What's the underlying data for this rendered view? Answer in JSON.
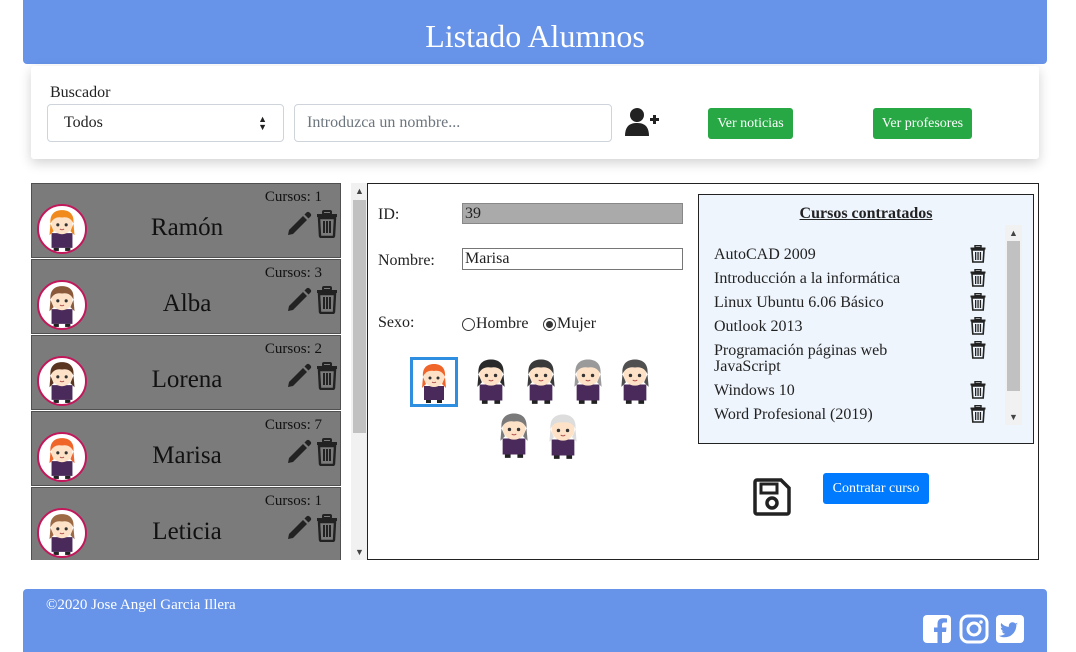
{
  "header": {
    "title": "Listado Alumnos"
  },
  "search": {
    "label": "Buscador",
    "filter_selected": "Todos",
    "name_placeholder": "Introduzca un nombre...",
    "name_value": "",
    "news_button": "Ver noticias",
    "teachers_button": "Ver profesores",
    "add_user_icon": "user-plus-icon"
  },
  "students": [
    {
      "name": "Ramón",
      "courses": "Cursos: 1",
      "avatar_hair": "#f08a1c"
    },
    {
      "name": "Alba",
      "courses": "Cursos: 3",
      "avatar_hair": "#8a5a3a"
    },
    {
      "name": "Lorena",
      "courses": "Cursos: 2",
      "avatar_hair": "#5a3620"
    },
    {
      "name": "Marisa",
      "courses": "Cursos: 7",
      "avatar_hair": "#f0662a"
    },
    {
      "name": "Leticia",
      "courses": "Cursos: 1",
      "avatar_hair": "#9c6a44"
    }
  ],
  "detail": {
    "id_label": "ID:",
    "id_value": "39",
    "name_label": "Nombre:",
    "name_value": "Marisa",
    "sex_label": "Sexo:",
    "sex_options": [
      "Hombre",
      "Mujer"
    ],
    "sex_selected": "Mujer",
    "save_icon": "floppy-disk-icon",
    "hire_button": "Contratar curso"
  },
  "courses": {
    "title": "Cursos contratados",
    "items": [
      "AutoCAD 2009",
      "Introducción a la informática",
      "Linux Ubuntu 6.06 Básico",
      "Outlook 2013",
      "Programación páginas web JavaScript",
      "Windows 10",
      "Word Profesional (2019)"
    ]
  },
  "footer": {
    "copyright": "©2020 Jose Angel Garcia Illera",
    "social_icons": [
      "facebook-icon",
      "instagram-icon",
      "twitter-icon"
    ]
  },
  "colors": {
    "header_blue": "#6793e9",
    "green": "#28a745",
    "blue": "#007bff",
    "list_gray": "#7b7b7b",
    "selected_border": "#2e8fe0"
  }
}
